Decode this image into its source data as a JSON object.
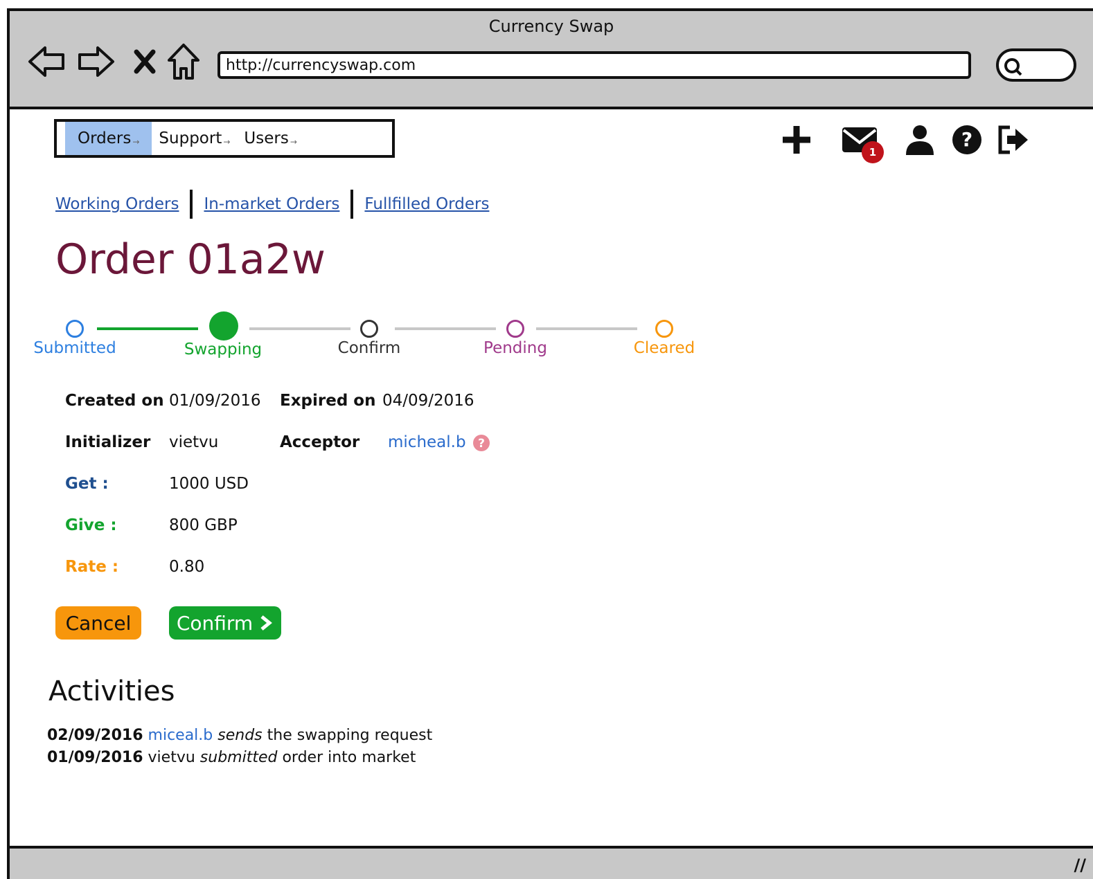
{
  "window": {
    "title": "Currency Swap"
  },
  "browser": {
    "url": "http://currencyswap.com"
  },
  "main_nav": {
    "items": [
      {
        "label": "Orders",
        "active": true
      },
      {
        "label": "Support",
        "active": false
      },
      {
        "label": "Users",
        "active": false
      }
    ]
  },
  "toolbar_icons": [
    "plus-icon",
    "mail-icon",
    "user-icon",
    "help-icon",
    "logout-icon"
  ],
  "notifications": {
    "unread_count": "1"
  },
  "subnav": {
    "links": [
      "Working Orders",
      "In-market Orders",
      "Fullfilled Orders"
    ]
  },
  "order": {
    "title": "Order 01a2w"
  },
  "progress": {
    "steps": [
      {
        "label": "Submitted",
        "color": "#2d7fe0"
      },
      {
        "label": "Swapping",
        "color": "#13a42e",
        "current": true
      },
      {
        "label": "Confirm",
        "color": "#333333"
      },
      {
        "label": "Pending",
        "color": "#a03a8b"
      },
      {
        "label": "Cleared",
        "color": "#f7960c"
      }
    ]
  },
  "details": {
    "created_label": "Created on",
    "created_value": "01/09/2016",
    "expired_label": "Expired on",
    "expired_value": "04/09/2016",
    "initializer_label": "Initializer",
    "initializer_value": "vietvu",
    "acceptor_label": "Acceptor",
    "acceptor_value": "micheal.b",
    "get_label": "Get :",
    "get_value": "1000 USD",
    "give_label": "Give :",
    "give_value": "800 GBP",
    "rate_label": "Rate :",
    "rate_value": "0.80"
  },
  "actions": {
    "cancel_label": "Cancel",
    "confirm_label": "Confirm"
  },
  "activities": {
    "heading": "Activities",
    "entries": [
      {
        "date": "02/09/2016",
        "user": "miceal.b",
        "verb": "sends",
        "rest": "the swapping request",
        "user_link": true
      },
      {
        "date": "01/09/2016",
        "user": "vietvu",
        "verb": "submitted",
        "rest": "order into market",
        "user_link": false
      }
    ]
  },
  "colors": {
    "title": "#6b1739",
    "active_tab": "#9fc1ee",
    "link": "#2653a8",
    "get": "#1f4f8f",
    "give": "#13a42e",
    "rate": "#f7960c"
  }
}
